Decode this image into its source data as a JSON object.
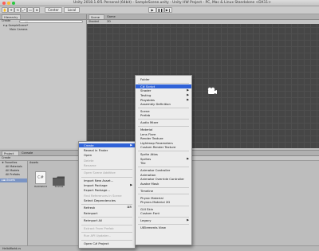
{
  "window": {
    "title": "Unity 2018.1.6f1 Personal (64bit) - SampleScene.unity - Unity HW Project - PC, Mac & Linux Standalone <DX11>"
  },
  "toolbar": {
    "pivot_label": "Center",
    "space_label": "Local"
  },
  "hierarchy": {
    "tab_label": "Hierarchy",
    "create_label": "Create",
    "search_placeholder": "All",
    "scene_name": "SampleScene*",
    "child": "Main Camera"
  },
  "scene": {
    "tabs": [
      {
        "label": "Scene"
      },
      {
        "label": "Game"
      }
    ],
    "shading_mode": "Shaded",
    "mode_2d": "2D"
  },
  "project": {
    "tabs": [
      {
        "label": "Project"
      },
      {
        "label": "Console"
      }
    ],
    "create_label": "Create",
    "favorites": {
      "label": "Favorites",
      "items": [
        "All Materials",
        "All Models",
        "All Prefabs"
      ]
    },
    "assets_label": "Assets",
    "breadcrumb": "Assets",
    "files": [
      {
        "name": "HelloWorld",
        "icon": "csharp-icon"
      },
      {
        "name": "Scenes",
        "icon": "folder-icon"
      }
    ],
    "footer_file": "HelloWorld.cs"
  },
  "context_menu": {
    "items": [
      {
        "label": "Create",
        "state": "selected",
        "arrow": true
      },
      {
        "label": "Reveal in Finder"
      },
      {
        "label": "Open"
      },
      {
        "label": "Delete",
        "state": "disabled"
      },
      {
        "label": "Rename",
        "state": "disabled"
      },
      {
        "label": "Open Scene Additive",
        "state": "disabled",
        "sep_before": true
      },
      {
        "label": "Import New Asset...",
        "sep_before": true
      },
      {
        "label": "Import Package",
        "arrow": true
      },
      {
        "label": "Export Package..."
      },
      {
        "label": "Find References In Scene",
        "state": "disabled"
      },
      {
        "label": "Select Dependencies"
      },
      {
        "label": "Refresh",
        "shortcut": "⌘R",
        "sep_before": true
      },
      {
        "label": "Reimport"
      },
      {
        "label": "Reimport All",
        "sep_before": true
      },
      {
        "label": "Extract From Prefab",
        "state": "disabled",
        "sep_before": true
      },
      {
        "label": "Run API Updater...",
        "state": "disabled",
        "sep_before": true
      },
      {
        "label": "Open C# Project",
        "sep_before": true
      }
    ]
  },
  "create_submenu": {
    "items": [
      {
        "label": "Folder"
      },
      {
        "label": "C# Script",
        "state": "selected",
        "sep_before": true
      },
      {
        "label": "Shader",
        "arrow": true
      },
      {
        "label": "Testing",
        "arrow": true
      },
      {
        "label": "Playables",
        "arrow": true
      },
      {
        "label": "Assembly Definition"
      },
      {
        "label": "Scene",
        "sep_before": true
      },
      {
        "label": "Prefab"
      },
      {
        "label": "Audio Mixer",
        "sep_before": true
      },
      {
        "label": "Material",
        "sep_before": true
      },
      {
        "label": "Lens Flare"
      },
      {
        "label": "Render Texture"
      },
      {
        "label": "Lightmap Parameters"
      },
      {
        "label": "Custom Render Texture"
      },
      {
        "label": "Sprite Atlas",
        "sep_before": true
      },
      {
        "label": "Sprites",
        "arrow": true
      },
      {
        "label": "Tile"
      },
      {
        "label": "Animator Controller",
        "sep_before": true
      },
      {
        "label": "Animation"
      },
      {
        "label": "Animator Override Controller"
      },
      {
        "label": "Avatar Mask"
      },
      {
        "label": "Timeline",
        "sep_before": true
      },
      {
        "label": "Physic Material",
        "sep_before": true
      },
      {
        "label": "Physics Material 2D"
      },
      {
        "label": "GUI Skin",
        "sep_before": true
      },
      {
        "label": "Custom Font"
      },
      {
        "label": "Legacy",
        "arrow": true,
        "sep_before": true
      },
      {
        "label": "UIElements View",
        "sep_before": true
      }
    ]
  }
}
